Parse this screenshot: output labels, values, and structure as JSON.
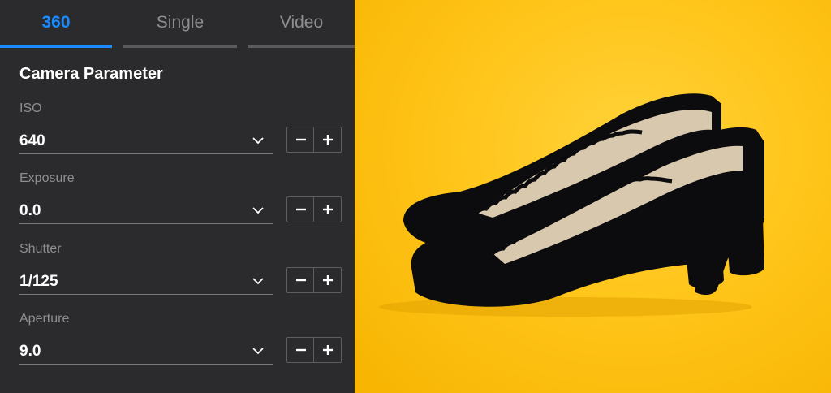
{
  "tabs": [
    {
      "label": "360",
      "active": true
    },
    {
      "label": "Single",
      "active": false
    },
    {
      "label": "Video",
      "active": false
    }
  ],
  "section_title": "Camera Parameter",
  "params": [
    {
      "label": "ISO",
      "value": "640"
    },
    {
      "label": "Exposure",
      "value": "0.0"
    },
    {
      "label": "Shutter",
      "value": "1/125"
    },
    {
      "label": "Aperture",
      "value": "9.0"
    }
  ],
  "colors": {
    "accent": "#1a8cff",
    "panel_bg": "#2b2b2d",
    "preview_bg": "#ffc51a",
    "shoe": "#0c0c0e"
  },
  "icons": {
    "dropdown": "chevron-down-icon",
    "decrement": "minus-icon",
    "increment": "plus-icon"
  },
  "preview": {
    "subject": "black suede scalloped pumps on yellow background"
  }
}
